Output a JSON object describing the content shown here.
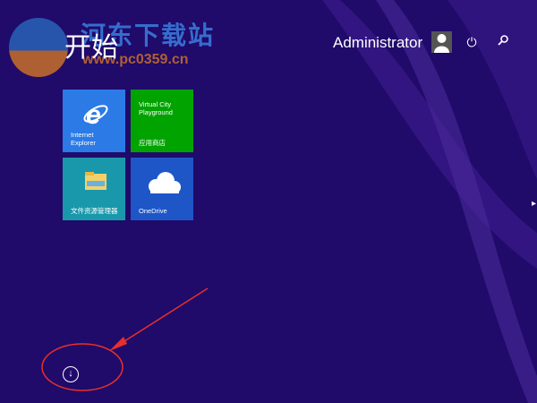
{
  "header": {
    "title": "开始",
    "user_name": "Administrator"
  },
  "watermark": {
    "title": "河东下载站",
    "url": "www.pc0359.cn"
  },
  "tiles": [
    {
      "label_line1": "Internet",
      "label_line2": "Explorer",
      "color": "#2b7ae6"
    },
    {
      "title_line1": "Virtual City",
      "title_line2": "Playground",
      "label": "应用商店",
      "color": "#00a300"
    },
    {
      "label": "文件资源管理器",
      "color": "#1998ac"
    },
    {
      "label": "OneDrive",
      "color": "#1e56c8"
    }
  ],
  "colors": {
    "background": "#200a6a",
    "annotation": "#e8302a"
  }
}
